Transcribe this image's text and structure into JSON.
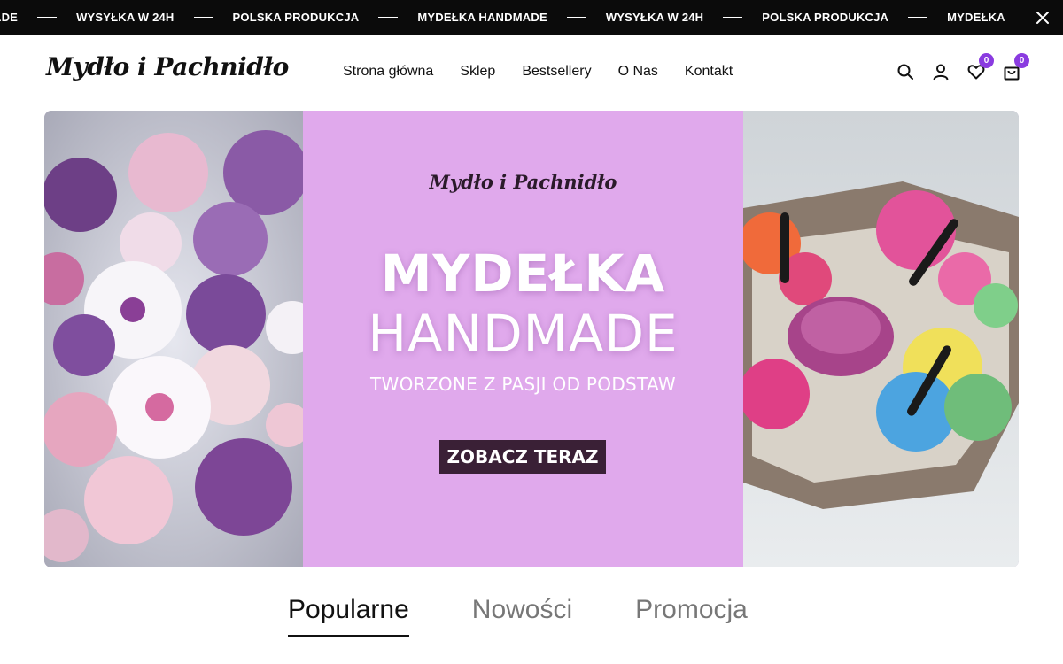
{
  "announcement": {
    "items": [
      "ADE",
      "WYSYŁKA W 24H",
      "POLSKA PRODUKCJA",
      "MYDEŁKA HANDMADE",
      "WYSYŁKA W 24H",
      "POLSKA PRODUKCJA",
      "MYDEŁKA"
    ]
  },
  "header": {
    "logo": "Mydło i Pachnidło",
    "nav": [
      "Strona główna",
      "Sklep",
      "Bestsellery",
      "O Nas",
      "Kontakt"
    ],
    "wishlist_count": "0",
    "cart_count": "0"
  },
  "hero": {
    "logo": "Mydło i Pachnidło",
    "title_line1": "MYDEŁKA",
    "title_line2": "HANDMADE",
    "subtitle": "TWORZONE Z PASJI OD PODSTAW",
    "cta": "ZOBACZ TERAZ"
  },
  "tabs": [
    "Popularne",
    "Nowości",
    "Promocja"
  ],
  "colors": {
    "accent": "#8a3be0",
    "hero_bg": "#e0a9ec",
    "cta_bg": "#3a2036",
    "topbar_bg": "#0b0b0b"
  }
}
